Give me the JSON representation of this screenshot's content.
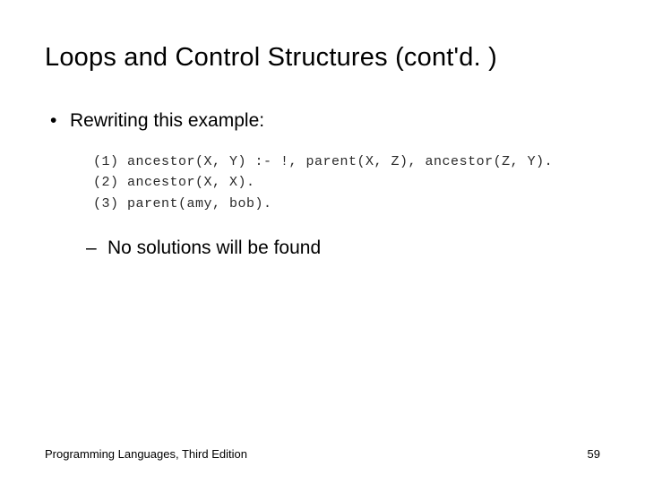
{
  "title": "Loops and Control Structures (cont'd. )",
  "bullet1": "Rewriting this example:",
  "code": {
    "line1": "(1)  ancestor(X, Y) :- !, parent(X, Z), ancestor(Z, Y).",
    "line2": "(2)  ancestor(X, X).",
    "line3": "(3)  parent(amy, bob)."
  },
  "bullet2": "No solutions will be found",
  "footer": {
    "left": "Programming Languages, Third Edition",
    "right": "59"
  }
}
